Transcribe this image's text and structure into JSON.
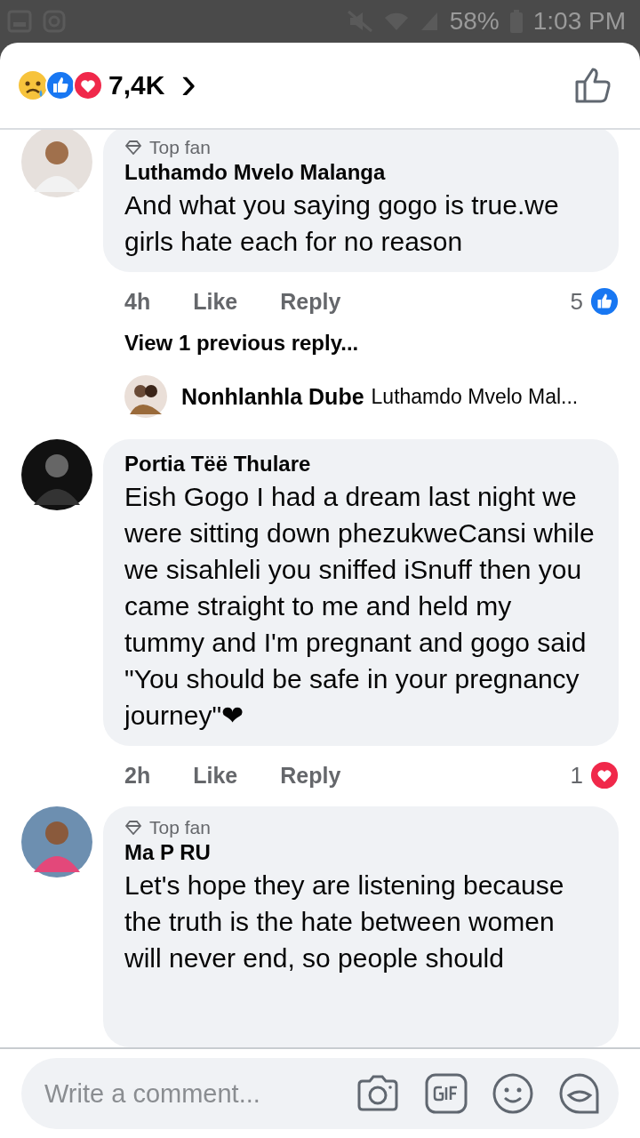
{
  "status_bar": {
    "battery": "58%",
    "time": "1:03 PM"
  },
  "header": {
    "reaction_count": "7,4K",
    "chevron": "›"
  },
  "comments": [
    {
      "top_fan": true,
      "badge": "Top fan",
      "author": "Luthamdo Mvelo Malanga",
      "text": "And what you saying gogo is true.we girls hate each for no reason",
      "time": "4h",
      "like": "Like",
      "reply": "Reply",
      "reaction_count": "5",
      "kind": "like",
      "view_replies": "View 1 previous reply...",
      "reply_preview": {
        "author": "Nonhlanhla Dube",
        "text": "Luthamdo Mvelo Mal..."
      }
    },
    {
      "top_fan": false,
      "author": "Portia Tëë Thulare",
      "text": "Eish Gogo I had a dream last night we were sitting down phezukweCansi while we sisahleli you sniffed iSnuff then you came straight to me and held my tummy and I'm pregnant and gogo said \"You should be safe in your pregnancy journey\"❤",
      "time": "2h",
      "like": "Like",
      "reply": "Reply",
      "reaction_count": "1",
      "kind": "love"
    },
    {
      "top_fan": true,
      "badge": "Top fan",
      "author": "Ma P RU",
      "text": "Let's hope they are listening because the truth is the hate between women will never end, so people should"
    }
  ],
  "composer": {
    "placeholder": "Write a comment..."
  }
}
